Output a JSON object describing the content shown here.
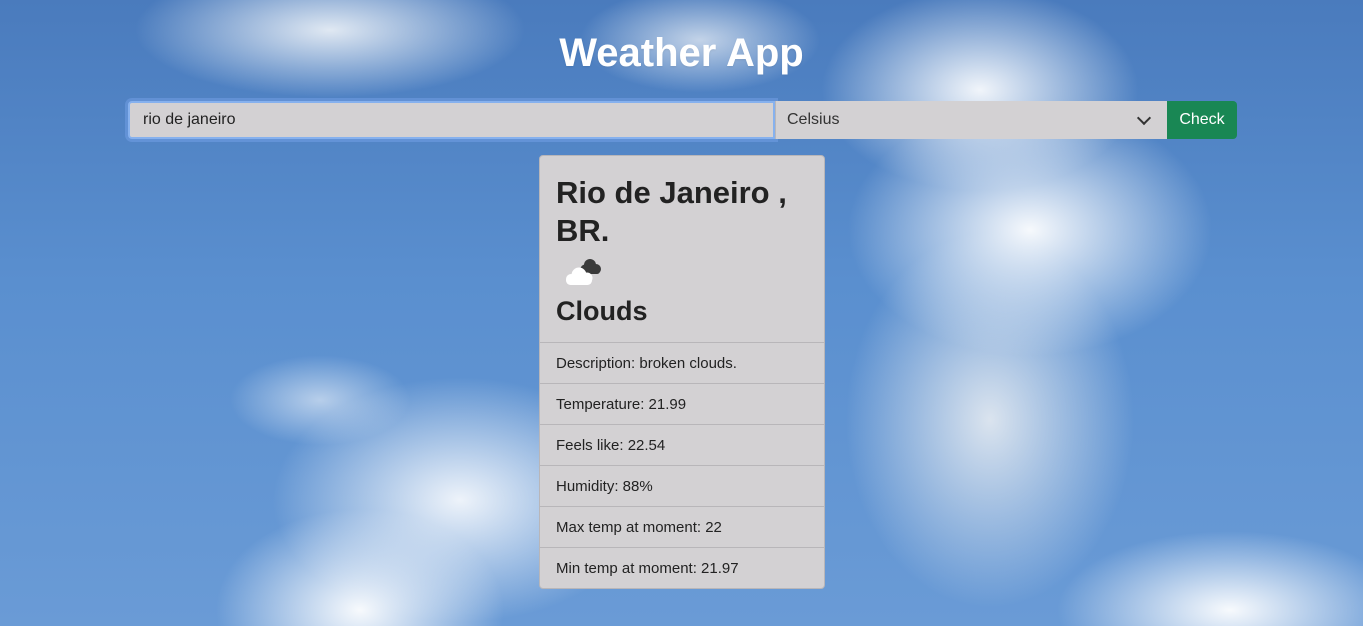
{
  "header": {
    "title": "Weather App"
  },
  "search": {
    "city_value": "rio de janeiro",
    "unit_selected": "Celsius",
    "check_label": "Check",
    "accent_color": "#198754"
  },
  "result": {
    "location": "Rio de Janeiro , BR.",
    "icon": "clouds-icon",
    "condition": "Clouds",
    "details": [
      "Description: broken clouds.",
      "Temperature: 21.99",
      "Feels like: 22.54",
      "Humidity: 88%",
      "Max temp at moment: 22",
      "Min temp at moment: 21.97"
    ]
  }
}
